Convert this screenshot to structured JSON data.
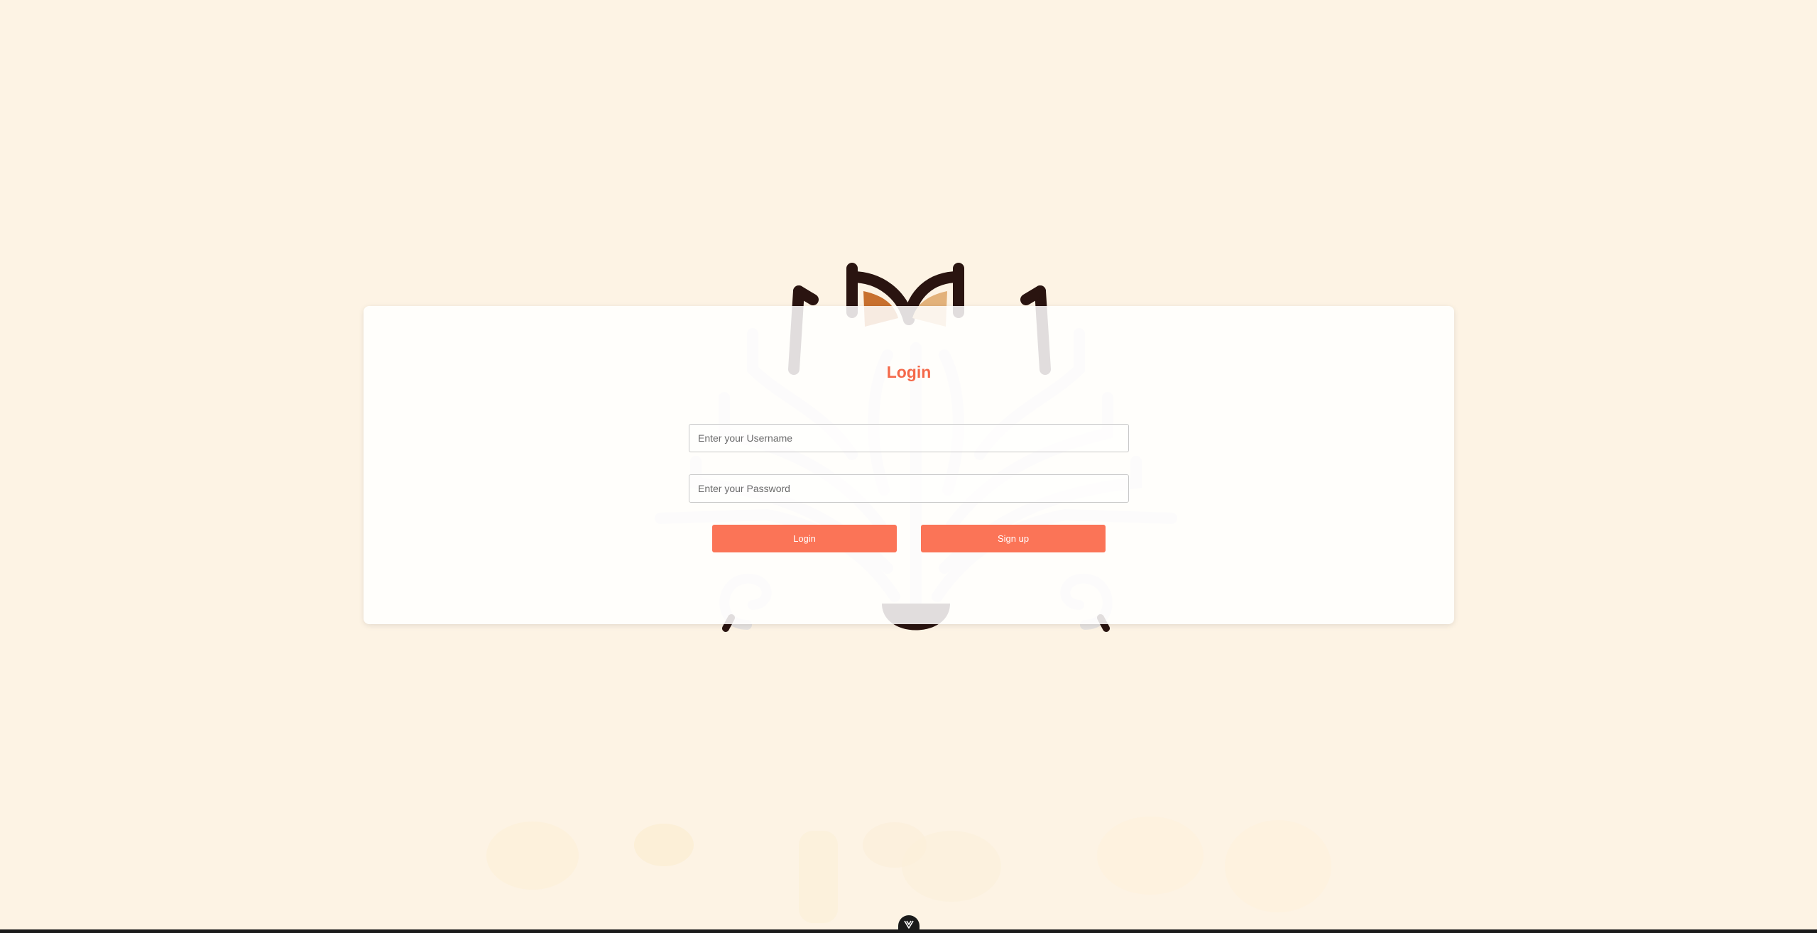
{
  "login_form": {
    "title": "Login",
    "username_placeholder": "Enter your Username",
    "password_placeholder": "Enter your Password",
    "login_label": "Login",
    "signup_label": "Sign up"
  },
  "colors": {
    "page_background": "#fdf3e4",
    "accent": "#f4694a",
    "button": "#fb7457"
  },
  "icons": {
    "background_logo": "decorative-logo-icon",
    "devtools_toggle": "vue-devtools-icon"
  }
}
